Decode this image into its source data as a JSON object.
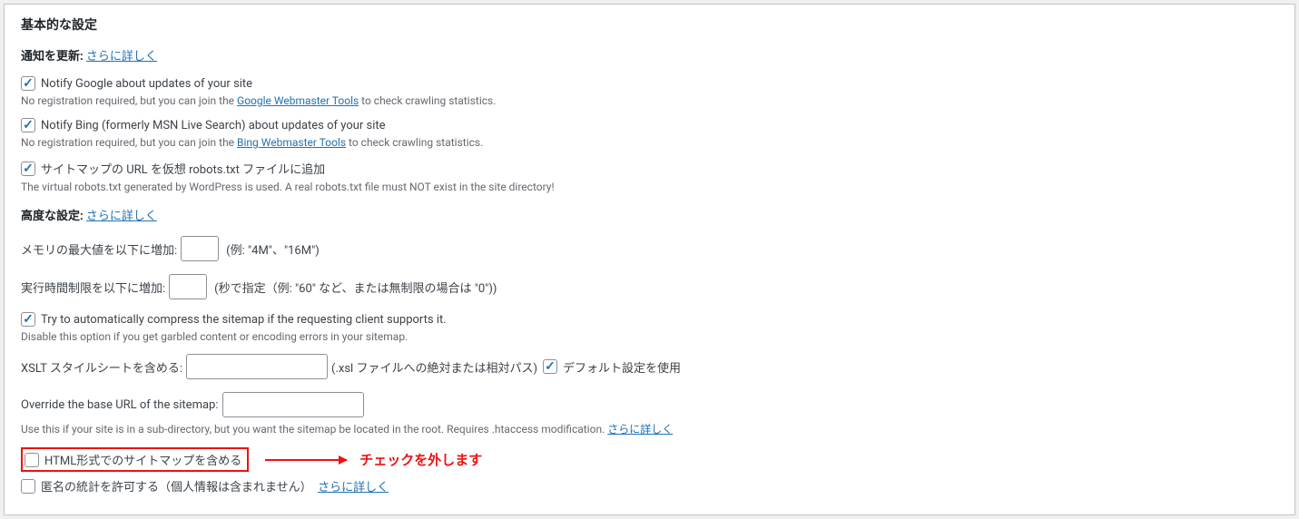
{
  "panel": {
    "title": "基本的な設定"
  },
  "notify_update": {
    "label": "通知を更新:",
    "link": "さらに詳しく"
  },
  "notify_google": {
    "label": "Notify Google about updates of your site",
    "note_pre": "No registration required, but you can join the ",
    "note_link": "Google Webmaster Tools",
    "note_post": " to check crawling statistics."
  },
  "notify_bing": {
    "label": "Notify Bing (formerly MSN Live Search) about updates of your site",
    "note_pre": "No registration required, but you can join the ",
    "note_link": "Bing Webmaster Tools",
    "note_post": " to check crawling statistics."
  },
  "robots": {
    "label": "サイトマップの URL を仮想 robots.txt ファイルに追加",
    "note": "The virtual robots.txt generated by WordPress is used. A real robots.txt file must NOT exist in the site directory!"
  },
  "advanced": {
    "label": "高度な設定:",
    "link": "さらに詳しく"
  },
  "memory": {
    "label": "メモリの最大値を以下に増加:",
    "hint": "(例: \"4M\"、\"16M\")"
  },
  "exec_time": {
    "label": "実行時間制限を以下に増加:",
    "hint": "(秒で指定（例: \"60\" など、または無制限の場合は \"0\"))"
  },
  "compress": {
    "label": "Try to automatically compress the sitemap if the requesting client supports it.",
    "note": "Disable this option if you get garbled content or encoding errors in your sitemap."
  },
  "xslt": {
    "label": "XSLT スタイルシートを含める:",
    "hint": "(.xsl ファイルへの絶対または相対パス)",
    "default_label": "デフォルト設定を使用"
  },
  "base_url": {
    "label": "Override the base URL of the sitemap:",
    "note_pre": "Use this if your site is in a sub-directory, but you want the sitemap be located in the root. Requires .htaccess modification. ",
    "note_link": "さらに詳しく"
  },
  "html_sitemap": {
    "label": "HTML形式でのサイトマップを含める",
    "annotation": "チェックを外します"
  },
  "anon_stats": {
    "label": "匿名の統計を許可する（個人情報は含まれません）",
    "link": "さらに詳しく"
  }
}
